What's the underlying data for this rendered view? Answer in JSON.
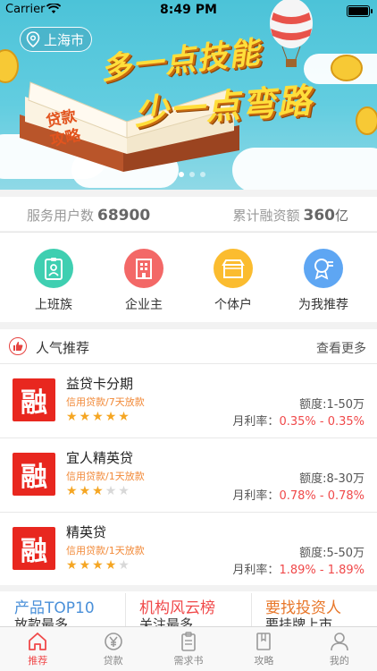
{
  "status_bar": {
    "carrier": "Carrier",
    "time": "8:49 PM"
  },
  "banner": {
    "location": "上海市",
    "slogan_line1": "多一点技能",
    "slogan_line2": "少一点弯路",
    "book_line1": "贷款",
    "book_line2": "攻略"
  },
  "stats": {
    "users_label": "服务用户数",
    "users_value": "68900",
    "financing_label": "累计融资额",
    "financing_value": "360",
    "financing_unit": "亿"
  },
  "categories": [
    {
      "label": "上班族",
      "color": "#3fcfb1",
      "icon": "id-badge-icon"
    },
    {
      "label": "企业主",
      "color": "#f36867",
      "icon": "building-icon"
    },
    {
      "label": "个体户",
      "color": "#fbbc2f",
      "icon": "shop-icon"
    },
    {
      "label": "为我推荐",
      "color": "#5ea6f3",
      "icon": "recommend-badge-icon"
    }
  ],
  "popular": {
    "title": "人气推荐",
    "more": "查看更多",
    "items": [
      {
        "logo_text": "融",
        "name": "益贷卡分期",
        "tags": "信用贷款/7天放款",
        "stars": 5,
        "amount": "额度:1-50万",
        "rate_label": "月利率：",
        "rate_value": "0.35% - 0.35%"
      },
      {
        "logo_text": "融",
        "name": "宜人精英贷",
        "tags": "信用贷款/1天放款",
        "stars": 3,
        "amount": "额度:8-30万",
        "rate_label": "月利率：",
        "rate_value": "0.78% - 0.78%"
      },
      {
        "logo_text": "融",
        "name": "精英贷",
        "tags": "信用贷款/1天放款",
        "stars": 4,
        "amount": "额度:5-50万",
        "rate_label": "月利率：",
        "rate_value": "1.89% - 1.89%"
      }
    ]
  },
  "cards": [
    {
      "title": "产品TOP10",
      "subtitle": "放款最多",
      "color": "#4a90d9"
    },
    {
      "title": "机构风云榜",
      "subtitle": "关注最多",
      "color": "#f0494a"
    },
    {
      "title": "要找投资人",
      "subtitle": "要挂牌上市",
      "color": "#e8772a"
    }
  ],
  "tabbar": [
    {
      "label": "推荐",
      "icon": "home-icon",
      "active": true
    },
    {
      "label": "贷款",
      "icon": "yen-coin-icon",
      "active": false
    },
    {
      "label": "需求书",
      "icon": "clipboard-icon",
      "active": false
    },
    {
      "label": "攻略",
      "icon": "book-icon",
      "active": false
    },
    {
      "label": "我的",
      "icon": "user-icon",
      "active": false
    }
  ],
  "colors": {
    "accent": "#f0494a",
    "star": "#f5a623",
    "tag": "#f28a39"
  }
}
